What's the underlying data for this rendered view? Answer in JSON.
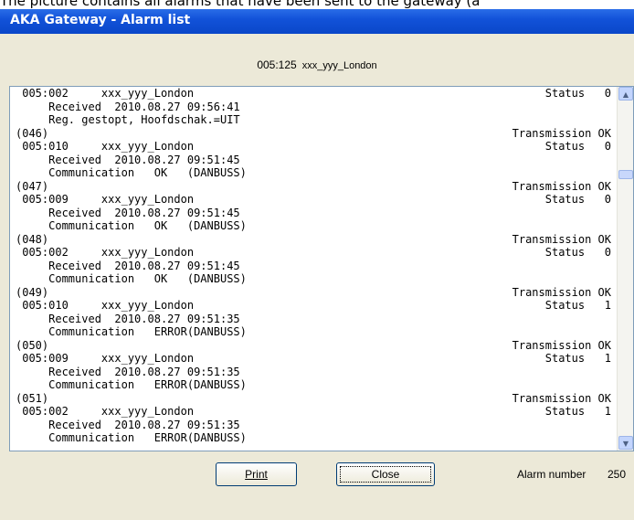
{
  "caption": "The picture contains all alarms that have been sent to the gateway (a",
  "window": {
    "title": "AKA Gateway - Alarm list"
  },
  "header": {
    "address": "005:125",
    "site": "xxx_yyy_London"
  },
  "alarm_lines": [
    {
      "left": " 005:002     xxx_yyy_London",
      "right": "Status   0"
    },
    {
      "left": "     Received  2010.08.27 09:56:41",
      "right": ""
    },
    {
      "left": "     Reg. gestopt, Hoofdschak.=UIT",
      "right": ""
    },
    {
      "left": "(046)",
      "right": "Transmission OK"
    },
    {
      "left": " 005:010     xxx_yyy_London",
      "right": "Status   0"
    },
    {
      "left": "     Received  2010.08.27 09:51:45",
      "right": ""
    },
    {
      "left": "     Communication   OK   (DANBUSS)",
      "right": ""
    },
    {
      "left": "(047)",
      "right": "Transmission OK"
    },
    {
      "left": " 005:009     xxx_yyy_London",
      "right": "Status   0"
    },
    {
      "left": "     Received  2010.08.27 09:51:45",
      "right": ""
    },
    {
      "left": "     Communication   OK   (DANBUSS)",
      "right": ""
    },
    {
      "left": "(048)",
      "right": "Transmission OK"
    },
    {
      "left": " 005:002     xxx_yyy_London",
      "right": "Status   0"
    },
    {
      "left": "     Received  2010.08.27 09:51:45",
      "right": ""
    },
    {
      "left": "     Communication   OK   (DANBUSS)",
      "right": ""
    },
    {
      "left": "(049)",
      "right": "Transmission OK"
    },
    {
      "left": " 005:010     xxx_yyy_London",
      "right": "Status   1"
    },
    {
      "left": "     Received  2010.08.27 09:51:35",
      "right": ""
    },
    {
      "left": "     Communication   ERROR(DANBUSS)",
      "right": ""
    },
    {
      "left": "(050)",
      "right": "Transmission OK"
    },
    {
      "left": " 005:009     xxx_yyy_London",
      "right": "Status   1"
    },
    {
      "left": "     Received  2010.08.27 09:51:35",
      "right": ""
    },
    {
      "left": "     Communication   ERROR(DANBUSS)",
      "right": ""
    },
    {
      "left": "(051)",
      "right": "Transmission OK"
    },
    {
      "left": " 005:002     xxx_yyy_London",
      "right": "Status   1"
    },
    {
      "left": "     Received  2010.08.27 09:51:35",
      "right": ""
    },
    {
      "left": "     Communication   ERROR(DANBUSS)",
      "right": ""
    }
  ],
  "buttons": {
    "print": "Print",
    "close": "Close"
  },
  "footer": {
    "alarm_number_label": "Alarm number",
    "alarm_number_value": "250"
  },
  "icons": {
    "scroll_up": "scroll-up-arrow-icon",
    "scroll_down": "scroll-down-arrow-icon"
  },
  "colors": {
    "titlebar": "#0a47c9",
    "window_bg": "#ece9d8",
    "list_border": "#7f9db9"
  }
}
